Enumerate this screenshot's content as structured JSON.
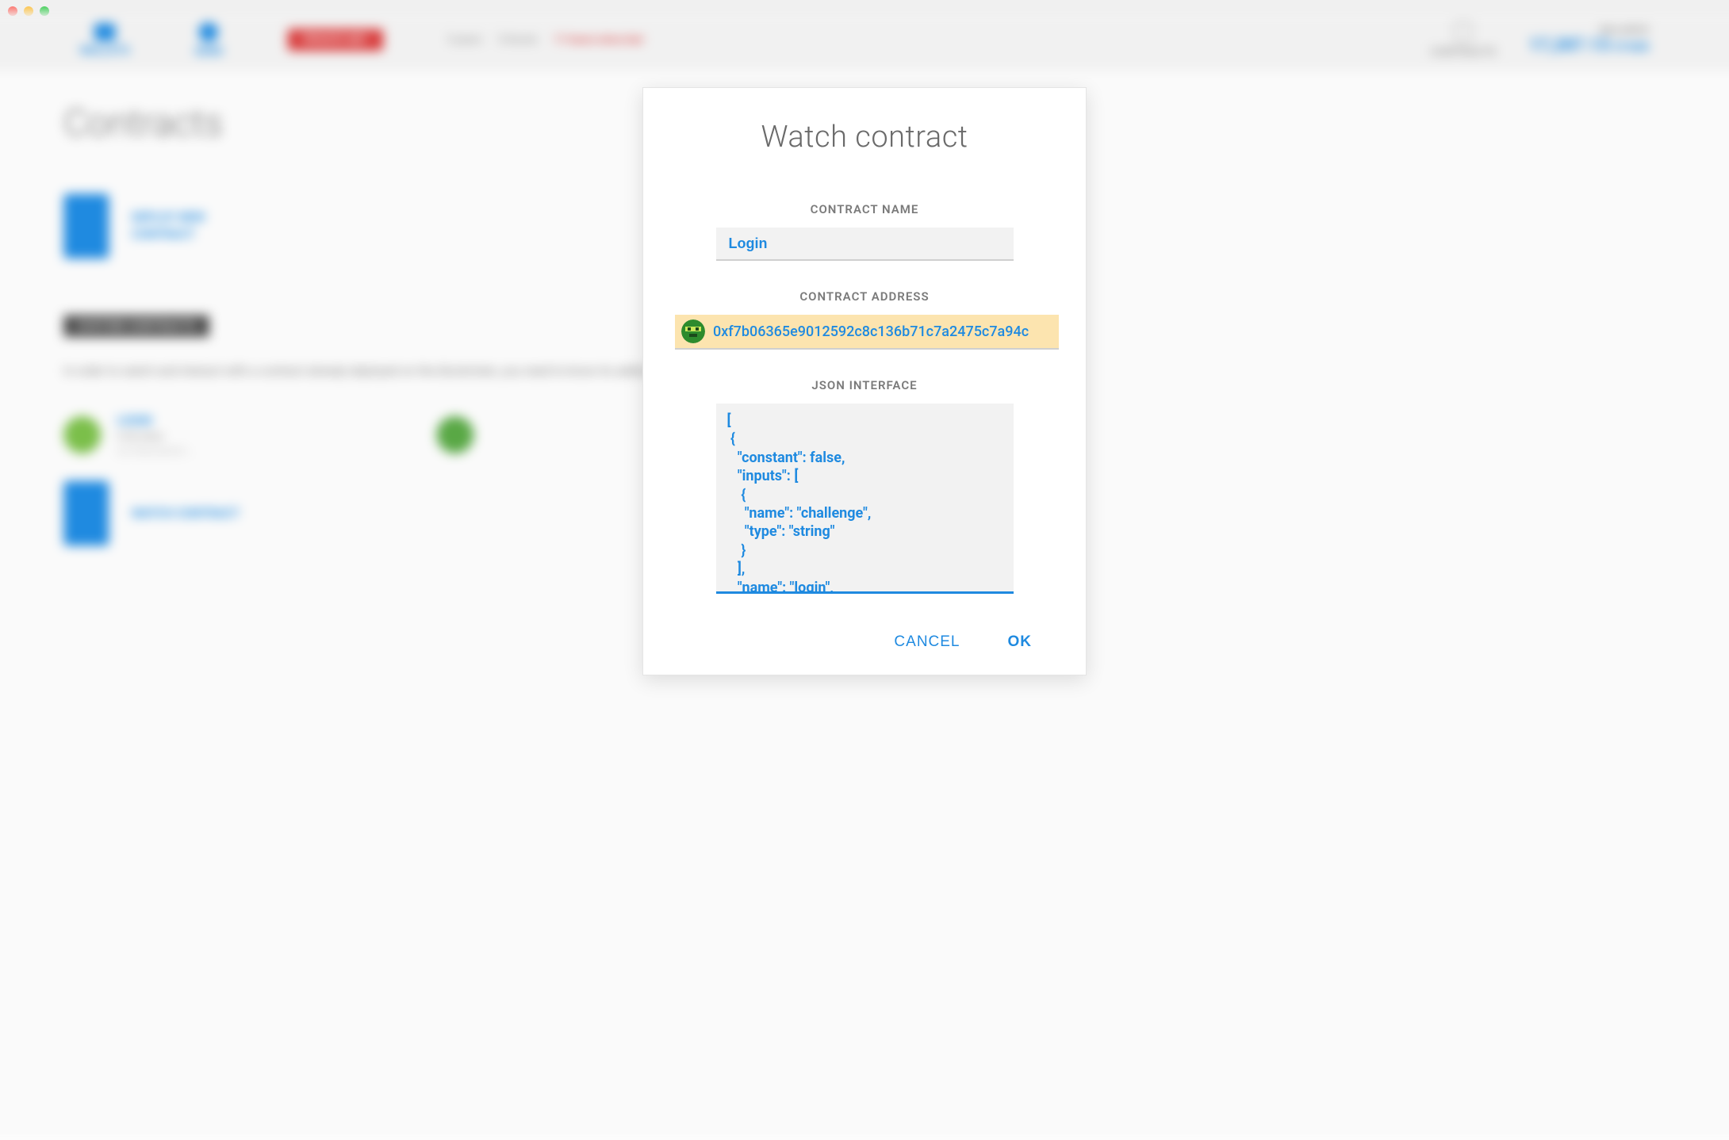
{
  "window": {
    "traffic_lights": [
      "close",
      "minimize",
      "zoom"
    ]
  },
  "background": {
    "nav": {
      "wallets": "WALLETS",
      "send": "SEND",
      "pill": "PRIVATE-NET",
      "status_peers": "0 peers",
      "status_block": "0 blocks",
      "status_warning": "11 hours since last",
      "status_action": "block",
      "contracts": "CONTRACTS",
      "balance_label": "BALANCE",
      "balance_value": "17,287.13",
      "balance_unit": "ETHER"
    },
    "page_title": "Contracts",
    "deploy_tile": "DEPLOY NEW\nCONTRACT",
    "custom_label": "CUSTOM CONTRACTS",
    "paragraph": "In order to watch and interact with a contract already deployed on the blockchain, you need to know its address and description of its interface in JSON format.",
    "card_login_title": "LOGIN",
    "card_login_sub": "0.00 ether",
    "card_login_sub2": "0xF7B06365E901...",
    "watch_tile": "WATCH CONTRACT"
  },
  "modal": {
    "title": "Watch contract",
    "labels": {
      "name": "CONTRACT NAME",
      "address": "CONTRACT ADDRESS",
      "json": "JSON INTERFACE"
    },
    "fields": {
      "name_value": "Login",
      "address_value": "0xf7b06365e9012592c8c136b71c7a2475c7a94c",
      "json_value": "[\n {\n   \"constant\": false,\n   \"inputs\": [\n    {\n     \"name\": \"challenge\",\n     \"type\": \"string\"\n    }\n   ],\n   \"name\": \"login\","
    },
    "buttons": {
      "cancel": "CANCEL",
      "ok": "OK"
    }
  }
}
